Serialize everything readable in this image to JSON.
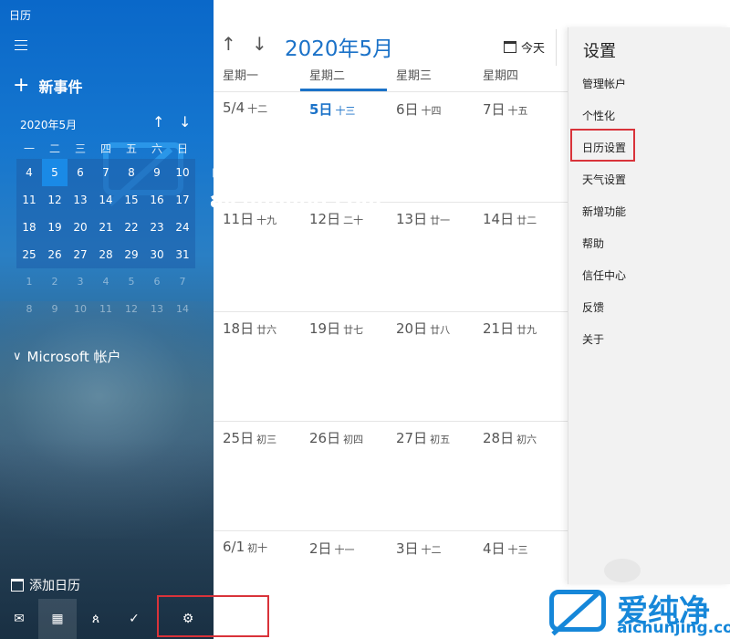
{
  "app": {
    "title": "日历"
  },
  "sidebar": {
    "new_event": "新事件",
    "mini_calendar": {
      "month_label": "2020年5月",
      "weekdays": [
        "一",
        "二",
        "三",
        "四",
        "五",
        "六",
        "日"
      ],
      "weeks": [
        [
          "4",
          "5",
          "6",
          "7",
          "8",
          "9",
          "10"
        ],
        [
          "11",
          "12",
          "13",
          "14",
          "15",
          "16",
          "17"
        ],
        [
          "18",
          "19",
          "20",
          "21",
          "22",
          "23",
          "24"
        ],
        [
          "25",
          "26",
          "27",
          "28",
          "29",
          "30",
          "31"
        ],
        [
          "1",
          "2",
          "3",
          "4",
          "5",
          "6",
          "7"
        ],
        [
          "8",
          "9",
          "10",
          "11",
          "12",
          "13",
          "14"
        ]
      ],
      "selected": "5"
    },
    "account_label": "Microsoft 帐户",
    "add_calendar": "添加日历",
    "bottom_icons": [
      "mail-icon",
      "calendar-icon",
      "people-icon",
      "todo-icon",
      "settings-gear-icon"
    ]
  },
  "main": {
    "month_title": "2020年5月",
    "today_label": "今天",
    "weekday_headers": [
      "星期一",
      "星期二",
      "星期三",
      "星期四"
    ],
    "weeks": [
      [
        {
          "date": "5/4",
          "lunar": "十二"
        },
        {
          "date": "5日",
          "lunar": "十三",
          "today": true
        },
        {
          "date": "6日",
          "lunar": "十四"
        },
        {
          "date": "7日",
          "lunar": "十五"
        }
      ],
      [
        {
          "date": "11日",
          "lunar": "十九"
        },
        {
          "date": "12日",
          "lunar": "二十"
        },
        {
          "date": "13日",
          "lunar": "廿一"
        },
        {
          "date": "14日",
          "lunar": "廿二"
        }
      ],
      [
        {
          "date": "18日",
          "lunar": "廿六"
        },
        {
          "date": "19日",
          "lunar": "廿七"
        },
        {
          "date": "20日",
          "lunar": "廿八"
        },
        {
          "date": "21日",
          "lunar": "廿九"
        }
      ],
      [
        {
          "date": "25日",
          "lunar": "初三"
        },
        {
          "date": "26日",
          "lunar": "初四"
        },
        {
          "date": "27日",
          "lunar": "初五"
        },
        {
          "date": "28日",
          "lunar": "初六"
        }
      ],
      [
        {
          "date": "6/1",
          "lunar": "初十"
        },
        {
          "date": "2日",
          "lunar": "十一"
        },
        {
          "date": "3日",
          "lunar": "十二"
        },
        {
          "date": "4日",
          "lunar": "十三"
        }
      ]
    ]
  },
  "settings": {
    "title": "设置",
    "items": [
      "管理帐户",
      "个性化",
      "日历设置",
      "天气设置",
      "新增功能",
      "帮助",
      "信任中心",
      "反馈",
      "关于"
    ],
    "highlighted": "日历设置"
  },
  "watermark": {
    "name": "爱纯净",
    "url": "aichunjing.com"
  },
  "colors": {
    "accent": "#1b72c8",
    "highlight_border": "#d9333a",
    "watermark_blue": "#1687d9"
  }
}
